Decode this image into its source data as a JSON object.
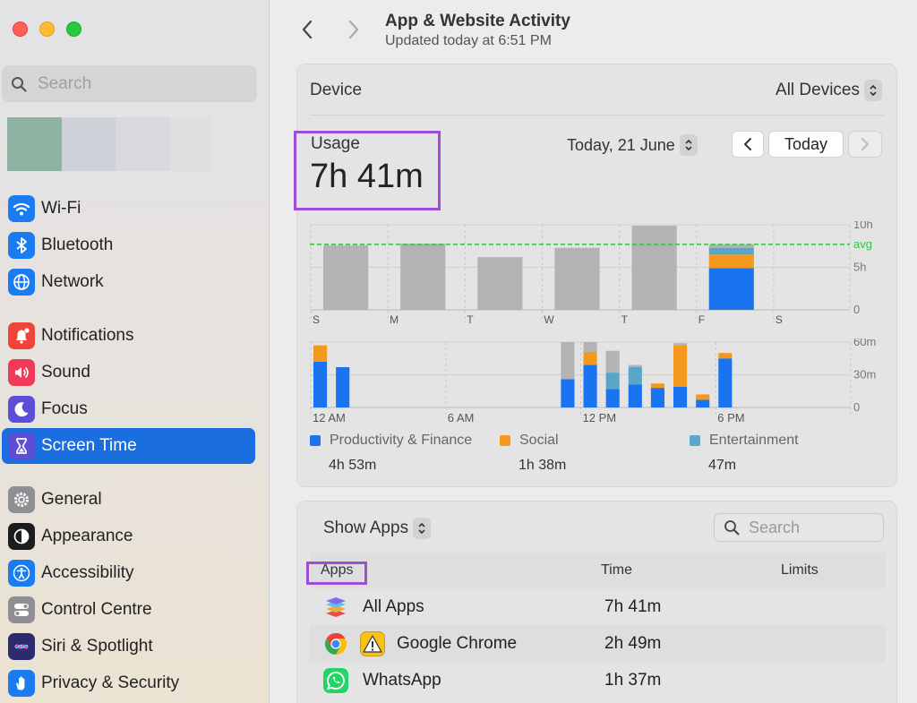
{
  "sidebar": {
    "search_placeholder": "Search",
    "items": [
      {
        "id": "wifi",
        "label": "Wi-Fi",
        "icon": "wifi-icon",
        "color": "#1a7cf0",
        "selected": false
      },
      {
        "id": "bluetooth",
        "label": "Bluetooth",
        "icon": "bluetooth-icon",
        "color": "#1a7cf0",
        "selected": false
      },
      {
        "id": "network",
        "label": "Network",
        "icon": "globe-icon",
        "color": "#1a7cf0",
        "selected": false
      },
      {
        "id": "notifications",
        "label": "Notifications",
        "icon": "bell-icon",
        "color": "#f0443a",
        "selected": false
      },
      {
        "id": "sound",
        "label": "Sound",
        "icon": "speaker-icon",
        "color": "#f03a5a",
        "selected": false
      },
      {
        "id": "focus",
        "label": "Focus",
        "icon": "moon-icon",
        "color": "#5a4fd6",
        "selected": false
      },
      {
        "id": "screen-time",
        "label": "Screen Time",
        "icon": "hourglass-icon",
        "color": "#5a4fd6",
        "selected": true
      },
      {
        "id": "general",
        "label": "General",
        "icon": "gear-icon",
        "color": "#8e8e93",
        "selected": false
      },
      {
        "id": "appearance",
        "label": "Appearance",
        "icon": "appearance-icon",
        "color": "#1c1c1e",
        "selected": false
      },
      {
        "id": "accessibility",
        "label": "Accessibility",
        "icon": "accessibility-icon",
        "color": "#1a7cf0",
        "selected": false
      },
      {
        "id": "control-centre",
        "label": "Control Centre",
        "icon": "toggles-icon",
        "color": "#8e8e93",
        "selected": false
      },
      {
        "id": "siri",
        "label": "Siri & Spotlight",
        "icon": "siri-icon",
        "color": "#2b2b6e",
        "selected": false
      },
      {
        "id": "privacy",
        "label": "Privacy & Security",
        "icon": "hand-icon",
        "color": "#1a7cf0",
        "selected": false
      }
    ]
  },
  "header": {
    "title": "App & Website Activity",
    "subtitle": "Updated today at 6:51 PM"
  },
  "device": {
    "label": "Device",
    "selector_value": "All Devices"
  },
  "usage": {
    "label": "Usage",
    "value": "7h 41m",
    "date": "Today, 21 June",
    "today_button": "Today"
  },
  "colors": {
    "productivity": "#1a74f0",
    "social": "#f5981e",
    "entertainment": "#5aa6c8",
    "other": "#b3b3b3",
    "avg_line": "#3cc24a",
    "highlight_box": "#9b4fd6"
  },
  "chart_data": [
    {
      "type": "bar",
      "stacked": true,
      "categories": [
        "S",
        "M",
        "T",
        "W",
        "T",
        "F",
        "S"
      ],
      "y_tick_labels": [
        "10h",
        "avg",
        "5h",
        "0"
      ],
      "ylim": [
        0,
        10
      ],
      "average": 7.7,
      "series": [
        {
          "name": "Productivity & Finance",
          "values": [
            0,
            0,
            0,
            0,
            0,
            4.9,
            0
          ]
        },
        {
          "name": "Social",
          "values": [
            0,
            0,
            0,
            0,
            0,
            1.6,
            0
          ]
        },
        {
          "name": "Entertainment",
          "values": [
            0,
            0,
            0,
            0,
            0,
            0.8,
            0
          ]
        },
        {
          "values": [
            7.6,
            7.8,
            6.2,
            7.3,
            9.9,
            0.4,
            0
          ]
        }
      ]
    },
    {
      "type": "bar",
      "stacked": true,
      "x_tick_labels": [
        "12 AM",
        "6 AM",
        "12 PM",
        "6 PM"
      ],
      "y_tick_labels": [
        "60m",
        "30m",
        "0"
      ],
      "ylim": [
        0,
        60
      ],
      "hours": [
        0,
        1,
        11,
        12,
        13,
        14,
        15,
        16,
        17,
        18,
        19
      ],
      "series": [
        {
          "name": "Productivity & Finance",
          "values": [
            42,
            37,
            26,
            39,
            17,
            21,
            18,
            19,
            7,
            45,
            0
          ]
        },
        {
          "name": "Social",
          "values": [
            15,
            0,
            0,
            12,
            0,
            0,
            4,
            38,
            5,
            5,
            0
          ]
        },
        {
          "name": "Entertainment",
          "values": [
            0,
            0,
            0,
            0,
            15,
            16,
            0,
            0,
            0,
            0,
            0
          ]
        },
        {
          "values": [
            0,
            0,
            34,
            9,
            20,
            2,
            0,
            2,
            0,
            0,
            0
          ]
        }
      ]
    }
  ],
  "legend": [
    {
      "name": "Productivity & Finance",
      "value": "4h 53m",
      "color": "#1a74f0"
    },
    {
      "name": "Social",
      "value": "1h 38m",
      "color": "#f5981e"
    },
    {
      "name": "Entertainment",
      "value": "47m",
      "color": "#5aa6c8"
    }
  ],
  "apps": {
    "show_label": "Show Apps",
    "search_placeholder": "Search",
    "columns": {
      "apps": "Apps",
      "time": "Time",
      "limits": "Limits"
    },
    "rows": [
      {
        "name": "All Apps",
        "time": "7h 41m",
        "icon": "all-apps-icon"
      },
      {
        "name": "Google Chrome",
        "time": "2h 49m",
        "icon": "chrome-icon",
        "badge": "warning-icon"
      },
      {
        "name": "WhatsApp",
        "time": "1h 37m",
        "icon": "whatsapp-icon"
      }
    ]
  }
}
